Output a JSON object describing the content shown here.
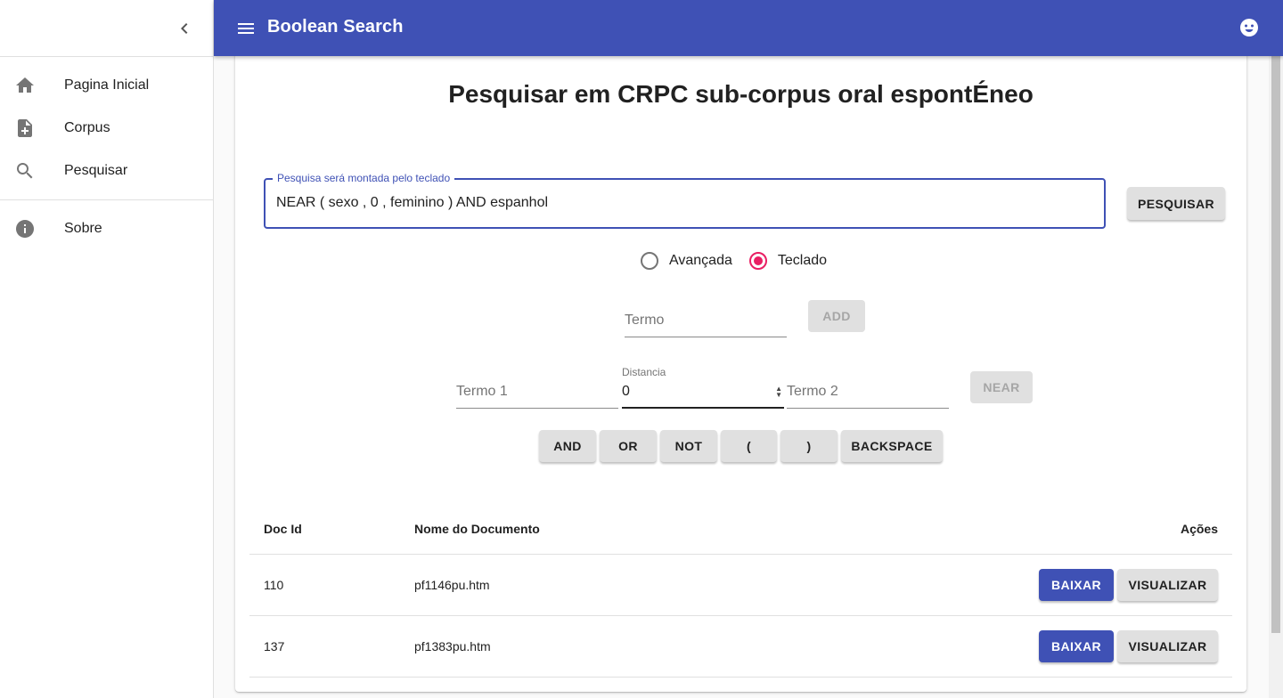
{
  "sidebar": {
    "items": [
      {
        "label": "Pagina Inicial",
        "icon": "home-icon"
      },
      {
        "label": "Corpus",
        "icon": "note-add-icon"
      },
      {
        "label": "Pesquisar",
        "icon": "search-icon"
      },
      {
        "label": "Sobre",
        "icon": "info-icon"
      }
    ]
  },
  "appbar": {
    "title": "Boolean Search"
  },
  "main": {
    "page_title": "Pesquisar em CRPC sub-corpus oral espontÉneo",
    "query_field": {
      "label": "Pesquisa será montada pelo teclado",
      "value": "NEAR ( sexo , 0 , feminino ) AND espanhol"
    },
    "search_button": "PESQUISAR",
    "mode": {
      "options": [
        "Avançada",
        "Teclado"
      ],
      "selected": "Teclado"
    },
    "term_field": {
      "placeholder": "Termo"
    },
    "add_button": "ADD",
    "near": {
      "term1_placeholder": "Termo 1",
      "distance_label": "Distancia",
      "distance_value": "0",
      "term2_placeholder": "Termo 2",
      "button": "NEAR"
    },
    "operators": [
      "AND",
      "OR",
      "NOT",
      "(",
      ")",
      "BACKSPACE"
    ]
  },
  "table": {
    "headers": {
      "doc_id": "Doc Id",
      "name": "Nome do Documento",
      "actions": "Ações"
    },
    "rows": [
      {
        "doc_id": "110",
        "name": "pf1146pu.htm"
      },
      {
        "doc_id": "137",
        "name": "pf1383pu.htm"
      }
    ],
    "download_label": "BAIXAR",
    "view_label": "VISUALIZAR"
  },
  "colors": {
    "primary": "#3f51b5",
    "accent": "#e91e63"
  }
}
